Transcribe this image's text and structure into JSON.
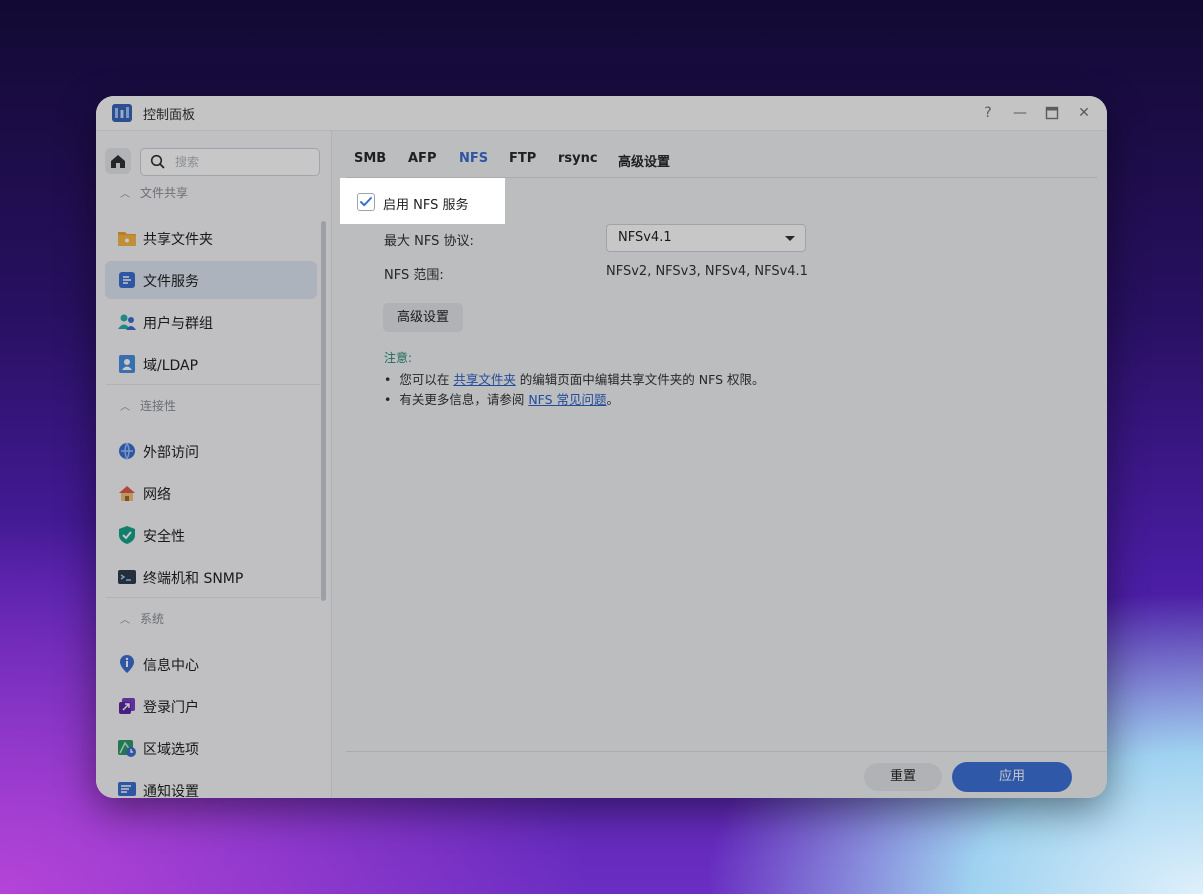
{
  "window": {
    "title": "控制面板"
  },
  "controls": {
    "help": "?",
    "minimize": "—",
    "maximize": "□",
    "close": "✕"
  },
  "search": {
    "placeholder": "搜索"
  },
  "sidebar": {
    "sections": [
      {
        "label": "文件共享",
        "items": [
          {
            "label": "共享文件夹",
            "icon": "shared-folder-icon"
          },
          {
            "label": "文件服务",
            "icon": "file-services-icon",
            "active": true
          },
          {
            "label": "用户与群组",
            "icon": "users-icon"
          },
          {
            "label": "域/LDAP",
            "icon": "domain-ldap-icon"
          }
        ]
      },
      {
        "label": "连接性",
        "items": [
          {
            "label": "外部访问",
            "icon": "external-access-icon"
          },
          {
            "label": "网络",
            "icon": "network-icon"
          },
          {
            "label": "安全性",
            "icon": "security-shield-icon"
          },
          {
            "label": "终端机和 SNMP",
            "icon": "terminal-icon"
          }
        ]
      },
      {
        "label": "系统",
        "items": [
          {
            "label": "信息中心",
            "icon": "info-icon"
          },
          {
            "label": "登录门户",
            "icon": "login-portal-icon"
          },
          {
            "label": "区域选项",
            "icon": "regional-options-icon"
          },
          {
            "label": "通知设置",
            "icon": "notification-icon"
          }
        ]
      }
    ]
  },
  "tabs": [
    "SMB",
    "AFP",
    "NFS",
    "FTP",
    "rsync",
    "高级设置"
  ],
  "active_tab": "NFS",
  "nfs": {
    "enable_label": "启用 NFS 服务",
    "enabled": true,
    "max_protocol_label": "最大 NFS 协议:",
    "max_protocol_value": "NFSv4.1",
    "range_label": "NFS 范围:",
    "range_value": "NFSv2, NFSv3, NFSv4, NFSv4.1",
    "advanced_button": "高级设置"
  },
  "note": {
    "title": "注意:",
    "line1_prefix": "您可以在 ",
    "line1_link": "共享文件夹",
    "line1_suffix": " 的编辑页面中编辑共享文件夹的 NFS 权限。",
    "line2_prefix": "有关更多信息，请参阅 ",
    "line2_link": "NFS 常见问题",
    "line2_suffix": "。"
  },
  "footer": {
    "reset": "重置",
    "apply": "应用"
  },
  "colors": {
    "accent": "#3d72d8",
    "active_tab": "#3b6ecf",
    "note_title": "#2c8a77",
    "link": "#2f62c7"
  }
}
